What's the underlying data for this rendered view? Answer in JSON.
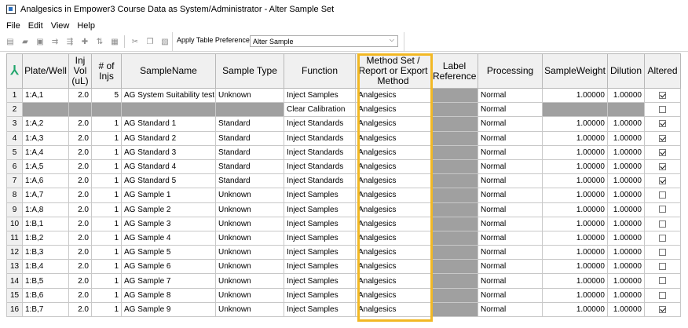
{
  "window": {
    "title": "Analgesics in Empower3 Course Data as System/Administrator - Alter Sample Set"
  },
  "menu": [
    "File",
    "Edit",
    "View",
    "Help"
  ],
  "toolbar": {
    "icons": [
      "new-row-icon",
      "open-icon",
      "save-icon",
      "fill-down-icon",
      "fill-icon",
      "insert-icon",
      "sort-icon",
      "grid-icon",
      "cut-icon",
      "copy-icon",
      "paste-icon"
    ],
    "pref_label": "Apply Table Preferences",
    "pref_value": "Alter Sample"
  },
  "columns": [
    "Plate/Well",
    "Inj Vol (uL)",
    "# of Injs",
    "SampleName",
    "Sample Type",
    "Function",
    "Method Set / Report or Export Method",
    "Label Reference",
    "Processing",
    "SampleWeight",
    "Dilution",
    "Altered"
  ],
  "rows": [
    {
      "n": "1",
      "well": "1:A,1",
      "vol": "2.0",
      "injs": "5",
      "name": "AG System Suitability test",
      "type": "Unknown",
      "func": "Inject Samples",
      "method": "Analgesics",
      "proc": "Normal",
      "weight": "1.00000",
      "dil": "1.00000",
      "altered": true
    },
    {
      "n": "2",
      "well": "",
      "vol": "",
      "injs": "",
      "name": "",
      "type": "",
      "func": "Clear Calibration",
      "method": "Analgesics",
      "proc": "Normal",
      "weight": "",
      "dil": "",
      "altered": false
    },
    {
      "n": "3",
      "well": "1:A,2",
      "vol": "2.0",
      "injs": "1",
      "name": "AG Standard 1",
      "type": "Standard",
      "func": "Inject Standards",
      "method": "Analgesics",
      "proc": "Normal",
      "weight": "1.00000",
      "dil": "1.00000",
      "altered": true
    },
    {
      "n": "4",
      "well": "1:A,3",
      "vol": "2.0",
      "injs": "1",
      "name": "AG Standard 2",
      "type": "Standard",
      "func": "Inject Standards",
      "method": "Analgesics",
      "proc": "Normal",
      "weight": "1.00000",
      "dil": "1.00000",
      "altered": true
    },
    {
      "n": "5",
      "well": "1:A,4",
      "vol": "2.0",
      "injs": "1",
      "name": "AG Standard 3",
      "type": "Standard",
      "func": "Inject Standards",
      "method": "Analgesics",
      "proc": "Normal",
      "weight": "1.00000",
      "dil": "1.00000",
      "altered": true
    },
    {
      "n": "6",
      "well": "1:A,5",
      "vol": "2.0",
      "injs": "1",
      "name": "AG Standard 4",
      "type": "Standard",
      "func": "Inject Standards",
      "method": "Analgesics",
      "proc": "Normal",
      "weight": "1.00000",
      "dil": "1.00000",
      "altered": true
    },
    {
      "n": "7",
      "well": "1:A,6",
      "vol": "2.0",
      "injs": "1",
      "name": "AG Standard 5",
      "type": "Standard",
      "func": "Inject Standards",
      "method": "Analgesics",
      "proc": "Normal",
      "weight": "1.00000",
      "dil": "1.00000",
      "altered": true
    },
    {
      "n": "8",
      "well": "1:A,7",
      "vol": "2.0",
      "injs": "1",
      "name": "AG Sample 1",
      "type": "Unknown",
      "func": "Inject Samples",
      "method": "Analgesics",
      "proc": "Normal",
      "weight": "1.00000",
      "dil": "1.00000",
      "altered": false
    },
    {
      "n": "9",
      "well": "1:A,8",
      "vol": "2.0",
      "injs": "1",
      "name": "AG Sample 2",
      "type": "Unknown",
      "func": "Inject Samples",
      "method": "Analgesics",
      "proc": "Normal",
      "weight": "1.00000",
      "dil": "1.00000",
      "altered": false
    },
    {
      "n": "10",
      "well": "1:B,1",
      "vol": "2.0",
      "injs": "1",
      "name": "AG Sample 3",
      "type": "Unknown",
      "func": "Inject Samples",
      "method": "Analgesics",
      "proc": "Normal",
      "weight": "1.00000",
      "dil": "1.00000",
      "altered": false
    },
    {
      "n": "11",
      "well": "1:B,2",
      "vol": "2.0",
      "injs": "1",
      "name": "AG Sample 4",
      "type": "Unknown",
      "func": "Inject Samples",
      "method": "Analgesics",
      "proc": "Normal",
      "weight": "1.00000",
      "dil": "1.00000",
      "altered": false
    },
    {
      "n": "12",
      "well": "1:B,3",
      "vol": "2.0",
      "injs": "1",
      "name": "AG Sample 5",
      "type": "Unknown",
      "func": "Inject Samples",
      "method": "Analgesics",
      "proc": "Normal",
      "weight": "1.00000",
      "dil": "1.00000",
      "altered": false
    },
    {
      "n": "13",
      "well": "1:B,4",
      "vol": "2.0",
      "injs": "1",
      "name": "AG Sample 6",
      "type": "Unknown",
      "func": "Inject Samples",
      "method": "Analgesics",
      "proc": "Normal",
      "weight": "1.00000",
      "dil": "1.00000",
      "altered": false
    },
    {
      "n": "14",
      "well": "1:B,5",
      "vol": "2.0",
      "injs": "1",
      "name": "AG Sample 7",
      "type": "Unknown",
      "func": "Inject Samples",
      "method": "Analgesics",
      "proc": "Normal",
      "weight": "1.00000",
      "dil": "1.00000",
      "altered": false
    },
    {
      "n": "15",
      "well": "1:B,6",
      "vol": "2.0",
      "injs": "1",
      "name": "AG Sample 8",
      "type": "Unknown",
      "func": "Inject Samples",
      "method": "Analgesics",
      "proc": "Normal",
      "weight": "1.00000",
      "dil": "1.00000",
      "altered": false
    },
    {
      "n": "16",
      "well": "1:B,7",
      "vol": "2.0",
      "injs": "1",
      "name": "AG Sample 9",
      "type": "Unknown",
      "func": "Inject Samples",
      "method": "Analgesics",
      "proc": "Normal",
      "weight": "1.00000",
      "dil": "1.00000",
      "altered": true
    }
  ],
  "colors": {
    "highlight": "#f2b824",
    "disabled_cell": "#a0a0a0",
    "header_bg": "#f0f0f0"
  }
}
